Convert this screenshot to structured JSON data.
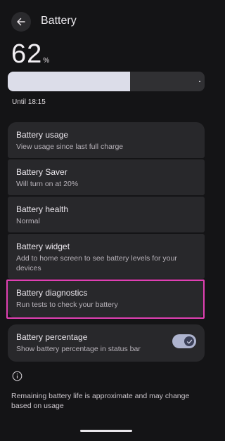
{
  "header": {
    "title": "Battery"
  },
  "battery": {
    "level": "62",
    "unit": "%",
    "level_fraction": 0.62,
    "until": "Until 18:15"
  },
  "items": [
    {
      "title": "Battery usage",
      "subtitle": "View usage since last full charge"
    },
    {
      "title": "Battery Saver",
      "subtitle": "Will turn on at 20%"
    },
    {
      "title": "Battery health",
      "subtitle": "Normal"
    },
    {
      "title": "Battery widget",
      "subtitle": "Add to home screen to see battery levels for your devices"
    },
    {
      "title": "Battery diagnostics",
      "subtitle": "Run tests to check your battery"
    }
  ],
  "percentage_setting": {
    "title": "Battery percentage",
    "subtitle": "Show battery percentage in status bar",
    "enabled": true
  },
  "footer": {
    "text": "Remaining battery life is approximate and may change based on usage"
  },
  "colors": {
    "highlight": "#e040b3",
    "bar_fill": "#dcdde9",
    "toggle_on": "#aeb4cf"
  }
}
